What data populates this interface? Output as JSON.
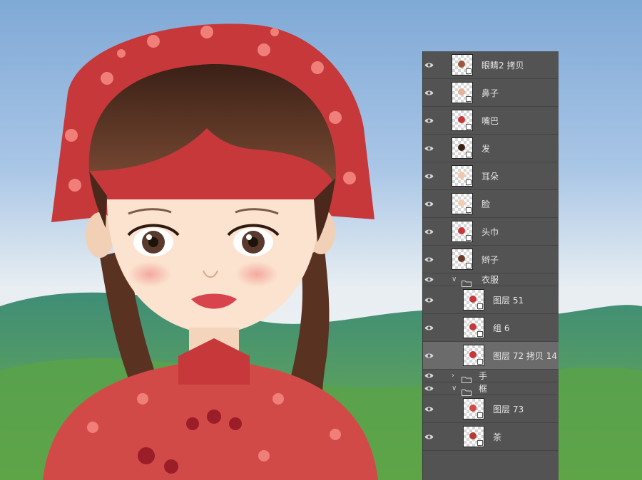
{
  "colors": {
    "panel_bg": "#535353",
    "selected_row": "#6b6b6b",
    "text": "#e6e6e6"
  },
  "layers": [
    {
      "label": "眼睛2 拷贝",
      "kind": "layer",
      "icon": "eye-icon"
    },
    {
      "label": "鼻子",
      "kind": "layer",
      "icon": "eye-icon"
    },
    {
      "label": "嘴巴",
      "kind": "layer",
      "icon": "eye-icon"
    },
    {
      "label": "发",
      "kind": "layer",
      "icon": "eye-icon"
    },
    {
      "label": "耳朵",
      "kind": "layer",
      "icon": "eye-icon"
    },
    {
      "label": "脸",
      "kind": "layer",
      "icon": "eye-icon"
    },
    {
      "label": "头巾",
      "kind": "layer",
      "icon": "eye-icon"
    },
    {
      "label": "辫子",
      "kind": "layer",
      "icon": "eye-icon"
    },
    {
      "label": "衣服",
      "kind": "group",
      "expanded": true,
      "icon": "folder-icon"
    },
    {
      "label": "图层 51",
      "kind": "layer",
      "indent": true
    },
    {
      "label": "组 6",
      "kind": "layer",
      "indent": true
    },
    {
      "label": "图层 72 拷贝 14",
      "kind": "layer",
      "indent": true,
      "selected": true
    },
    {
      "label": "手",
      "kind": "group",
      "expanded": false,
      "icon": "folder-icon"
    },
    {
      "label": "框",
      "kind": "group",
      "expanded": true,
      "icon": "folder-icon"
    },
    {
      "label": "图层 73",
      "kind": "layer",
      "indent": true
    },
    {
      "label": "茶",
      "kind": "layer",
      "indent": true
    }
  ]
}
